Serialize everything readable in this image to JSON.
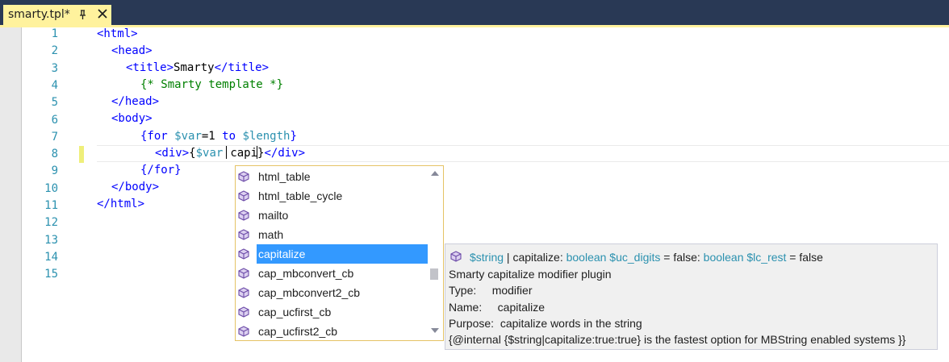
{
  "tab": {
    "title": "smarty.tpl*"
  },
  "gutter": {
    "line_numbers": [
      "1",
      "2",
      "3",
      "4",
      "5",
      "6",
      "7",
      "8",
      "9",
      "10",
      "11",
      "12",
      "13",
      "14",
      "15"
    ]
  },
  "code": {
    "l1": {
      "t1": "<html>"
    },
    "l2": {
      "t1": "<head>"
    },
    "l3": {
      "t1": "<title>",
      "t2": "Smarty",
      "t3": "</title>"
    },
    "l4": {
      "t1": "{* Smarty template *}"
    },
    "l5": {
      "t1": "</head>"
    },
    "l6": {
      "t1": "<body>"
    },
    "l7": {
      "t1": "{for ",
      "t2": "$var",
      "t3": "=1 ",
      "t4": "to",
      "t5": " ",
      "t6": "$length",
      "t7": "}"
    },
    "l8": {
      "t1": "<div>",
      "t2": "{",
      "t3": "$var",
      "t4": "capi",
      "t5": "}",
      "t6": "</div>"
    },
    "l9": {
      "t1": "{/for}"
    },
    "l10": {
      "t1": "</body>"
    },
    "l11": {
      "t1": "</html>"
    }
  },
  "completion": {
    "items": [
      {
        "label": "html_table",
        "icon": "plugin-cube-icon"
      },
      {
        "label": "html_table_cycle",
        "icon": "plugin-cube-icon"
      },
      {
        "label": "mailto",
        "icon": "plugin-cube-icon"
      },
      {
        "label": "math",
        "icon": "plugin-cube-icon"
      },
      {
        "label": "capitalize",
        "icon": "plugin-cube-icon",
        "selected": true
      },
      {
        "label": "cap_mbconvert_cb",
        "icon": "plugin-cube-icon"
      },
      {
        "label": "cap_mbconvert2_cb",
        "icon": "plugin-cube-icon"
      },
      {
        "label": "cap_ucfirst_cb",
        "icon": "plugin-cube-icon"
      },
      {
        "label": "cap_ucfirst2_cb",
        "icon": "plugin-cube-icon"
      }
    ]
  },
  "tooltip": {
    "sig": {
      "s1": "$string",
      "s2": " | capitalize: ",
      "s3": "boolean $uc_digits",
      "s4": " = false: ",
      "s5": "boolean $lc_rest",
      "s6": " = false"
    },
    "description": "Smarty capitalize modifier plugin",
    "type_line": "Type:     modifier",
    "name_line": "Name:     capitalize",
    "purpose_line": "Purpose:  capitalize words in the string",
    "internal_line": "{@internal {$string|capitalize:true:true} is the fastest option for MBString enabled systems }}"
  },
  "colors": {
    "title_bar": "#293955",
    "tab_active": "#fff29d",
    "selection": "#3399ff",
    "line_number": "#2b91af",
    "tag": "#0000ff",
    "comment": "#008000",
    "variable": "#2b91af"
  }
}
